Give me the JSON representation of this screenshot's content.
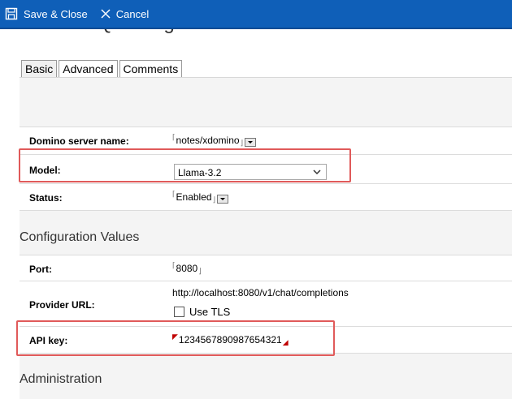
{
  "toolbar": {
    "save_label": "Save & Close",
    "cancel_label": "Cancel"
  },
  "page": {
    "title": "Domino IQ Configuration"
  },
  "tabs": [
    {
      "label": "Basic"
    },
    {
      "label": "Advanced"
    },
    {
      "label": "Comments"
    }
  ],
  "basic": {
    "server_label": "Domino server name:",
    "server_value": "notes/xdomino",
    "model_label": "Model:",
    "model_value": "Llama-3.2",
    "status_label": "Status:",
    "status_value": "Enabled"
  },
  "config": {
    "heading": "Configuration Values",
    "port_label": "Port:",
    "port_value": "8080",
    "provider_label": "Provider URL:",
    "provider_value": "http://localhost:8080/v1/chat/completions",
    "tls_label": "Use TLS",
    "apikey_label": "API key:",
    "apikey_value": "1234567890987654321"
  },
  "admin": {
    "heading": "Administration"
  },
  "colors": {
    "toolbar_bg": "#0f5fb8",
    "highlight": "#e05a5a"
  }
}
